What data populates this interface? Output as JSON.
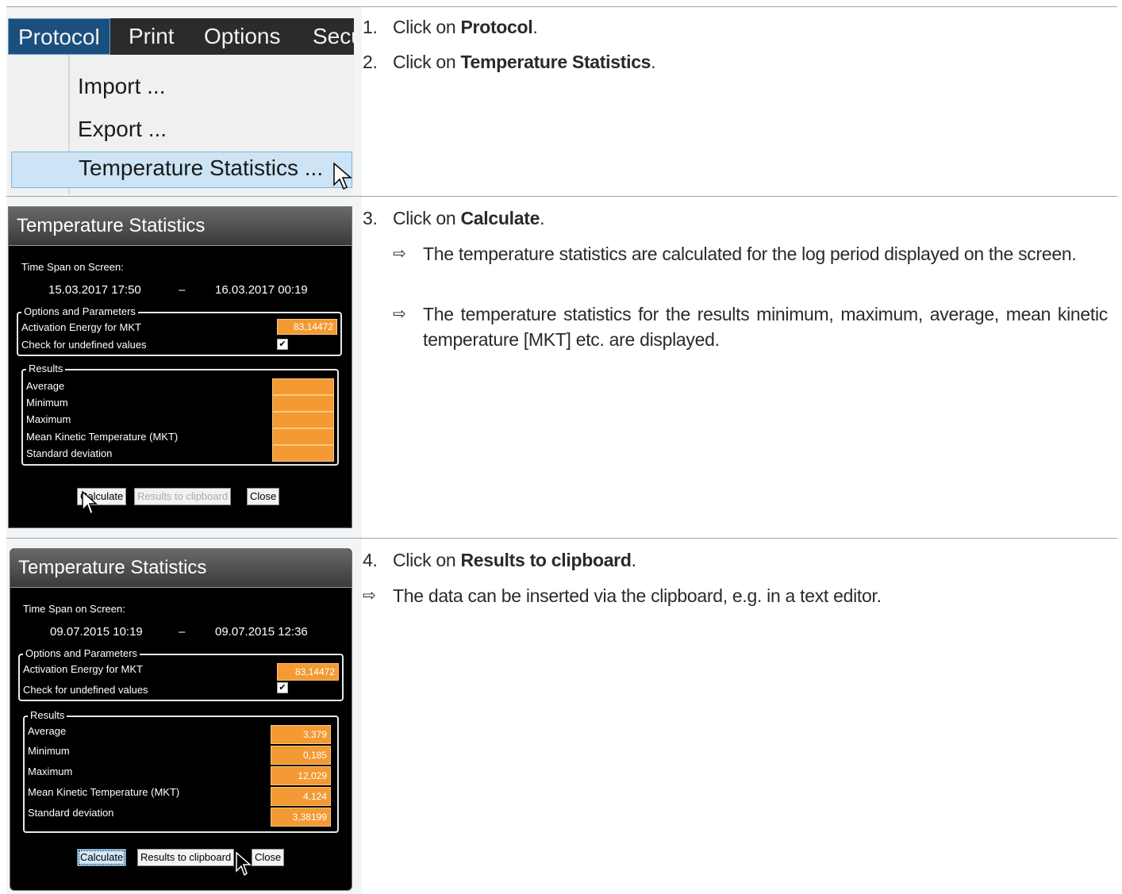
{
  "menu": {
    "bar": [
      "Protocol",
      "Print",
      "Options",
      "Secu"
    ],
    "items": [
      "Import ...",
      "Export ...",
      "Temperature Statistics ..."
    ]
  },
  "steps": {
    "s1": {
      "num": "1.",
      "pre": "Click on ",
      "bold": "Protocol",
      "post": "."
    },
    "s2": {
      "num": "2.",
      "pre": "Click on ",
      "bold": "Temperature Statistics",
      "post": "."
    },
    "s3": {
      "num": "3.",
      "pre": "Click on ",
      "bold": "Calculate",
      "post": "."
    },
    "r3a": "The temperature statistics are calculated for the log period displayed on the screen.",
    "r3b": "The temperature statistics for the results minimum, maximum, average, mean kinetic temperature [MKT] etc. are displayed.",
    "s4": {
      "num": "4.",
      "pre": "Click on ",
      "bold": "Results to clipboard",
      "post": "."
    },
    "r4": "The data can be inserted via the clipboard, e.g. in a text editor.",
    "arrow": "⇨"
  },
  "dialog1": {
    "title": "Temperature Statistics",
    "time_span_label": "Time Span on Screen:",
    "date_from": "15.03.2017 17:50",
    "dash": "–",
    "date_to": "16.03.2017 00:19",
    "options_title": "Options and Parameters",
    "activation_label": "Activation Energy for MKT",
    "activation_value": "83,14472",
    "check_label": "Check for undefined values",
    "check_mark": "✔",
    "results_title": "Results",
    "results": [
      {
        "label": "Average",
        "value": ""
      },
      {
        "label": "Minimum",
        "value": ""
      },
      {
        "label": "Maximum",
        "value": ""
      },
      {
        "label": "Mean Kinetic Temperature (MKT)",
        "value": ""
      },
      {
        "label": "Standard deviation",
        "value": ""
      }
    ],
    "buttons": [
      "Calculate",
      "Results to clipboard",
      "Close"
    ]
  },
  "dialog2": {
    "title": "Temperature Statistics",
    "time_span_label": "Time Span on Screen:",
    "date_from": "09.07.2015 10:19",
    "dash": "–",
    "date_to": "09.07.2015 12:36",
    "options_title": "Options and Parameters",
    "activation_label": "Activation Energy for MKT",
    "activation_value": "83,14472",
    "check_label": "Check for undefined values",
    "check_mark": "✔",
    "results_title": "Results",
    "results": [
      {
        "label": "Average",
        "value": "3,379"
      },
      {
        "label": "Minimum",
        "value": "0,185"
      },
      {
        "label": "Maximum",
        "value": "12,029"
      },
      {
        "label": "Mean Kinetic Temperature (MKT)",
        "value": "4,124"
      },
      {
        "label": "Standard deviation",
        "value": "3,38199"
      }
    ],
    "buttons": [
      "Calculate",
      "Results to clipboard",
      "Close"
    ]
  },
  "colors": {
    "accent_orange": "#f39a34",
    "menu_highlight": "#cce4f5",
    "menubar_bg": "#2b2b2b",
    "rule": "#9aa4ad"
  }
}
